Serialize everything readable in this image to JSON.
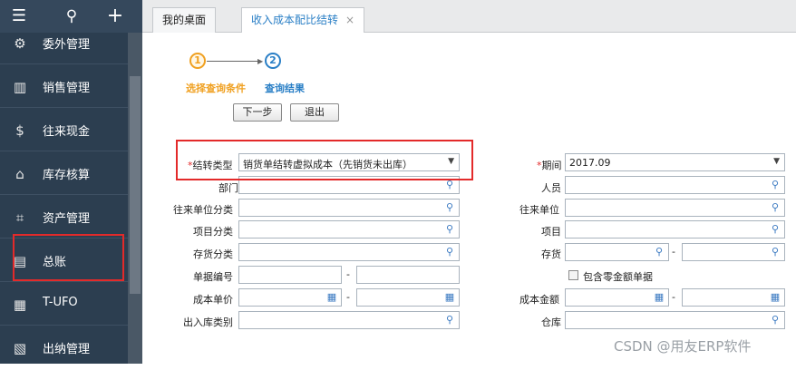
{
  "sidebar": {
    "items": [
      {
        "label": "委外管理",
        "icon": "outsourcing-icon"
      },
      {
        "label": "销售管理",
        "icon": "sales-chart-icon"
      },
      {
        "label": "往来现金",
        "icon": "dollar-circle-icon"
      },
      {
        "label": "库存核算",
        "icon": "warehouse-icon"
      },
      {
        "label": "资产管理",
        "icon": "asset-icon"
      },
      {
        "label": "总账",
        "icon": "ledger-icon"
      },
      {
        "label": "T-UFO",
        "icon": "calculator-icon"
      },
      {
        "label": "出纳管理",
        "icon": "cashier-icon"
      }
    ]
  },
  "tabs": [
    {
      "label": "我的桌面"
    },
    {
      "label": "收入成本配比结转",
      "close": "×"
    }
  ],
  "steps": {
    "step1_num": "1",
    "step2_num": "2",
    "step1_label": "选择查询条件",
    "step2_label": "查询结果",
    "next_label": "下一步",
    "exit_label": "退出"
  },
  "form": {
    "required_mark": "*",
    "dash": "-",
    "transfer_type_label": "结转类型",
    "transfer_type_value": "销货单结转虚拟成本（先销货未出库）",
    "period_label": "期间",
    "period_value": "2017.09",
    "department_label": "部门",
    "staff_label": "人员",
    "partner_class_label": "往来单位分类",
    "partner_label": "往来单位",
    "project_class_label": "项目分类",
    "project_label": "项目",
    "stock_class_label": "存货分类",
    "stock_label": "存货",
    "doc_no_label": "单据编号",
    "include_zero_label": "包含零金额单据",
    "unit_cost_label": "成本单价",
    "cost_amount_label": "成本金额",
    "io_type_label": "出入库类别",
    "warehouse_label": "仓库"
  },
  "watermark": "CSDN @用友ERP软件",
  "colors": {
    "accent": "#2a7fc6",
    "highlight": "#e32a2a",
    "step_active": "#f0a020",
    "sidebar": "#2c3e50"
  }
}
